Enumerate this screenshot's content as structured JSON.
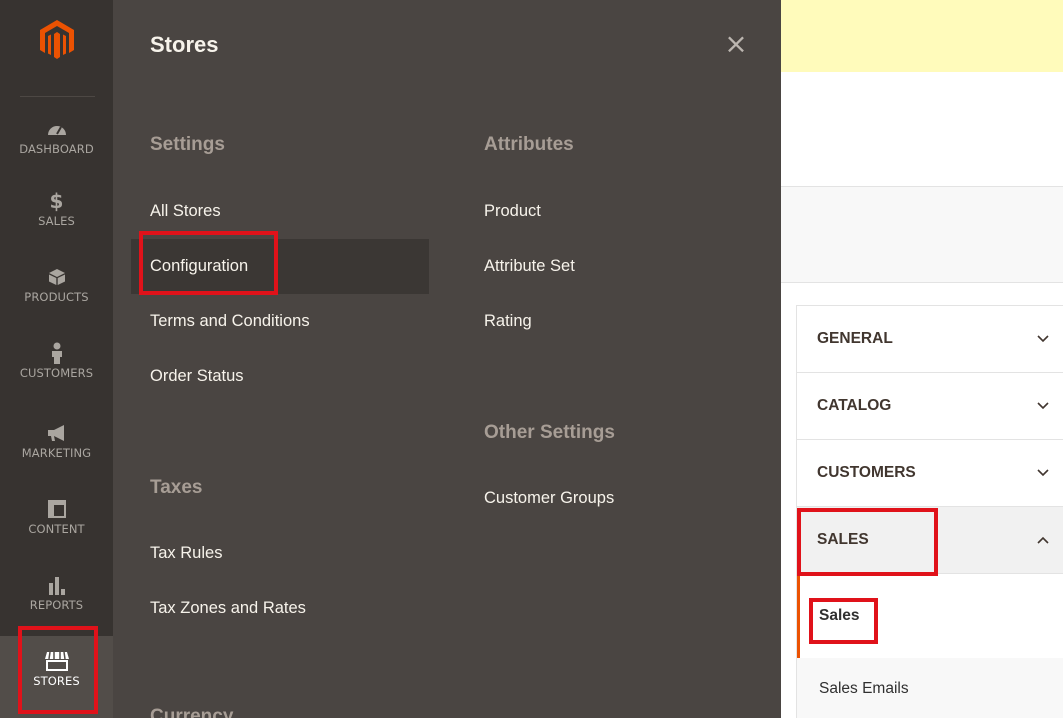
{
  "nav": {
    "items": [
      {
        "id": "dashboard",
        "label": "DASHBOARD",
        "icon": "dashboard-gauge-icon"
      },
      {
        "id": "sales",
        "label": "SALES",
        "icon": "dollar-icon"
      },
      {
        "id": "products",
        "label": "PRODUCTS",
        "icon": "cube-icon"
      },
      {
        "id": "customers",
        "label": "CUSTOMERS",
        "icon": "person-icon"
      },
      {
        "id": "marketing",
        "label": "MARKETING",
        "icon": "megaphone-icon"
      },
      {
        "id": "content",
        "label": "CONTENT",
        "icon": "layout-icon"
      },
      {
        "id": "reports",
        "label": "REPORTS",
        "icon": "bar-chart-icon"
      },
      {
        "id": "stores",
        "label": "STORES",
        "icon": "store-icon"
      }
    ],
    "active": "stores"
  },
  "flyout": {
    "title": "Stores",
    "close_symbol": "×",
    "settings": {
      "title": "Settings",
      "items": [
        "All Stores",
        "Configuration",
        "Terms and Conditions",
        "Order Status"
      ]
    },
    "taxes": {
      "title": "Taxes",
      "items": [
        "Tax Rules",
        "Tax Zones and Rates"
      ]
    },
    "currency": {
      "title": "Currency"
    },
    "attributes": {
      "title": "Attributes",
      "items": [
        "Product",
        "Attribute Set",
        "Rating"
      ]
    },
    "other_settings": {
      "title": "Other Settings",
      "items": [
        "Customer Groups"
      ]
    }
  },
  "config_nav": {
    "tabs": [
      {
        "label": "GENERAL",
        "state": "collapsed"
      },
      {
        "label": "CATALOG",
        "state": "collapsed"
      },
      {
        "label": "CUSTOMERS",
        "state": "collapsed"
      },
      {
        "label": "SALES",
        "state": "expanded"
      }
    ],
    "sales_items": [
      "Sales",
      "Sales Emails"
    ]
  },
  "colors": {
    "nav_bg": "#373330",
    "flyout_bg": "#4a4542",
    "accent": "#eb5202",
    "highlight": "#e0121a",
    "notice_bg": "#fffbbb"
  }
}
